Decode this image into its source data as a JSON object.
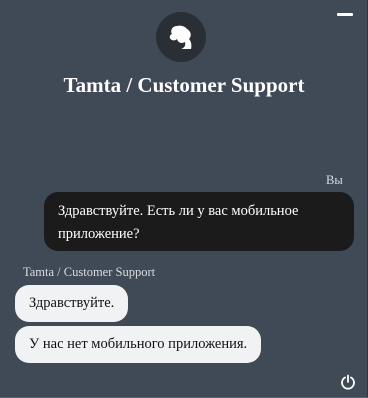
{
  "header": {
    "title": "Tamta / Customer Support",
    "avatar_icon": "user-silhouette-icon",
    "minimize_icon": "minimize-icon"
  },
  "messages": [
    {
      "sender": "Вы",
      "text": "Здравствуйте. Есть ли у вас мобильное приложение?",
      "role": "user"
    },
    {
      "sender": "Tamta / Customer Support",
      "text": "Здравствуйте.",
      "role": "agent"
    },
    {
      "sender": "Tamta / Customer Support",
      "text": "У нас нет мобильного приложения.",
      "role": "agent"
    }
  ],
  "footer": {
    "power_icon": "power-icon"
  },
  "colors": {
    "background": "#404956",
    "user_bubble": "#1b1b1b",
    "agent_bubble": "#f1f2f3",
    "avatar_bg": "#2a2f36"
  }
}
